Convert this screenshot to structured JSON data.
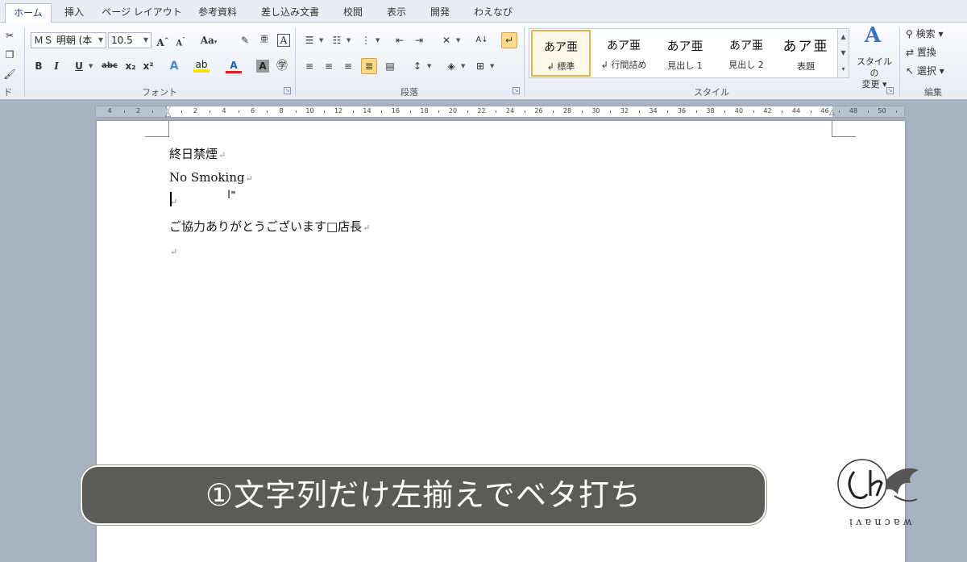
{
  "tabs": [
    "ホーム",
    "挿入",
    "ページ レイアウト",
    "参考資料",
    "差し込み文書",
    "校閲",
    "表示",
    "開発",
    "わえなび"
  ],
  "ribbon": {
    "clipboard_label": "ド",
    "font": {
      "name": "ＭＳ 明朝 (本",
      "size": "10.5",
      "grow": "A",
      "shrink": "A",
      "case": "Aa",
      "bold": "B",
      "italic": "I",
      "underline": "U",
      "strike": "abc",
      "subscript": "x₂",
      "superscript": "x²",
      "group_label": "フォント"
    },
    "paragraph": {
      "group_label": "段落"
    },
    "styles": {
      "group_label": "スタイル",
      "items": [
        {
          "sample": "あア亜",
          "name": "↲ 標準"
        },
        {
          "sample": "あア亜",
          "name": "↲ 行間詰め"
        },
        {
          "sample": "あア亜",
          "name": "見出し 1"
        },
        {
          "sample": "あア亜",
          "name": "見出し 2"
        },
        {
          "sample": "あア亜",
          "name": "表題"
        }
      ],
      "change_line1": "スタイルの",
      "change_line2": "変更"
    },
    "editing": {
      "find": "検索",
      "replace": "置換",
      "select": "選択",
      "group_label": "編集"
    }
  },
  "ruler": {
    "numbers": [
      "4",
      "2",
      "",
      "2",
      "4",
      "6",
      "8",
      "10",
      "12",
      "14",
      "16",
      "18",
      "20",
      "22",
      "24",
      "26",
      "28",
      "30",
      "32",
      "34",
      "36",
      "38",
      "40",
      "42",
      "44",
      "46",
      "48",
      "50"
    ]
  },
  "document": {
    "lines": [
      "終日禁煙",
      "No Smoking",
      "",
      "ご協力ありがとうございます□店長",
      ""
    ]
  },
  "caption": "①文字列だけ左揃えでベタ打ち",
  "logo_text": "wacnavi"
}
